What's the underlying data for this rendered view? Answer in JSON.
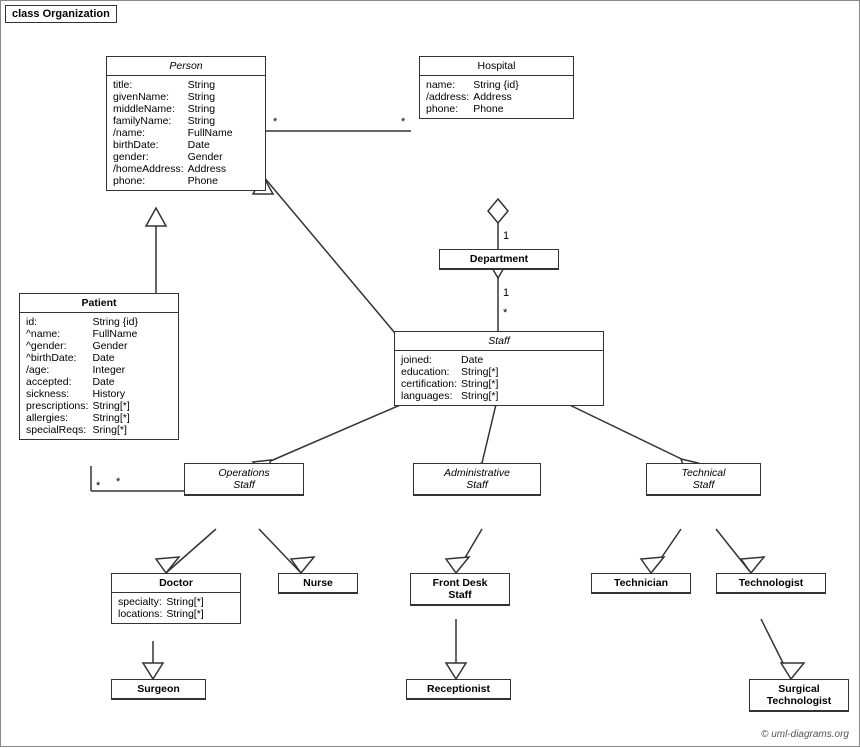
{
  "diagram": {
    "title": "class Organization",
    "copyright": "© uml-diagrams.org"
  },
  "classes": {
    "person": {
      "title": "Person",
      "italic": true,
      "attributes": [
        [
          "title:",
          "String"
        ],
        [
          "givenName:",
          "String"
        ],
        [
          "middleName:",
          "String"
        ],
        [
          "familyName:",
          "String"
        ],
        [
          "/name:",
          "FullName"
        ],
        [
          "birthDate:",
          "Date"
        ],
        [
          "gender:",
          "Gender"
        ],
        [
          "/homeAddress:",
          "Address"
        ],
        [
          "phone:",
          "Phone"
        ]
      ]
    },
    "hospital": {
      "title": "Hospital",
      "italic": false,
      "attributes": [
        [
          "name:",
          "String {id}"
        ],
        [
          "/address:",
          "Address"
        ],
        [
          "phone:",
          "Phone"
        ]
      ]
    },
    "patient": {
      "title": "Patient",
      "bold": true,
      "attributes": [
        [
          "id:",
          "String {id}"
        ],
        [
          "^name:",
          "FullName"
        ],
        [
          "^gender:",
          "Gender"
        ],
        [
          "^birthDate:",
          "Date"
        ],
        [
          "/age:",
          "Integer"
        ],
        [
          "accepted:",
          "Date"
        ],
        [
          "sickness:",
          "History"
        ],
        [
          "prescriptions:",
          "String[*]"
        ],
        [
          "allergies:",
          "String[*]"
        ],
        [
          "specialReqs:",
          "Sring[*]"
        ]
      ]
    },
    "department": {
      "title": "Department",
      "bold": true,
      "attributes": []
    },
    "staff": {
      "title": "Staff",
      "italic": true,
      "attributes": [
        [
          "joined:",
          "Date"
        ],
        [
          "education:",
          "String[*]"
        ],
        [
          "certification:",
          "String[*]"
        ],
        [
          "languages:",
          "String[*]"
        ]
      ]
    },
    "operations_staff": {
      "title": "Operations Staff",
      "italic": true,
      "multiline": true,
      "attributes": []
    },
    "administrative_staff": {
      "title": "Administrative Staff",
      "italic": true,
      "multiline": true,
      "attributes": []
    },
    "technical_staff": {
      "title": "Technical Staff",
      "italic": true,
      "multiline": true,
      "attributes": []
    },
    "doctor": {
      "title": "Doctor",
      "bold": true,
      "attributes": [
        [
          "specialty:",
          "String[*]"
        ],
        [
          "locations:",
          "String[*]"
        ]
      ]
    },
    "nurse": {
      "title": "Nurse",
      "bold": true,
      "attributes": []
    },
    "front_desk_staff": {
      "title": "Front Desk Staff",
      "bold": true,
      "multiline": true,
      "attributes": []
    },
    "technician": {
      "title": "Technician",
      "bold": true,
      "attributes": []
    },
    "technologist": {
      "title": "Technologist",
      "bold": true,
      "attributes": []
    },
    "surgeon": {
      "title": "Surgeon",
      "bold": true,
      "attributes": []
    },
    "receptionist": {
      "title": "Receptionist",
      "bold": true,
      "attributes": []
    },
    "surgical_technologist": {
      "title": "Surgical Technologist",
      "bold": true,
      "multiline": true,
      "attributes": []
    }
  }
}
